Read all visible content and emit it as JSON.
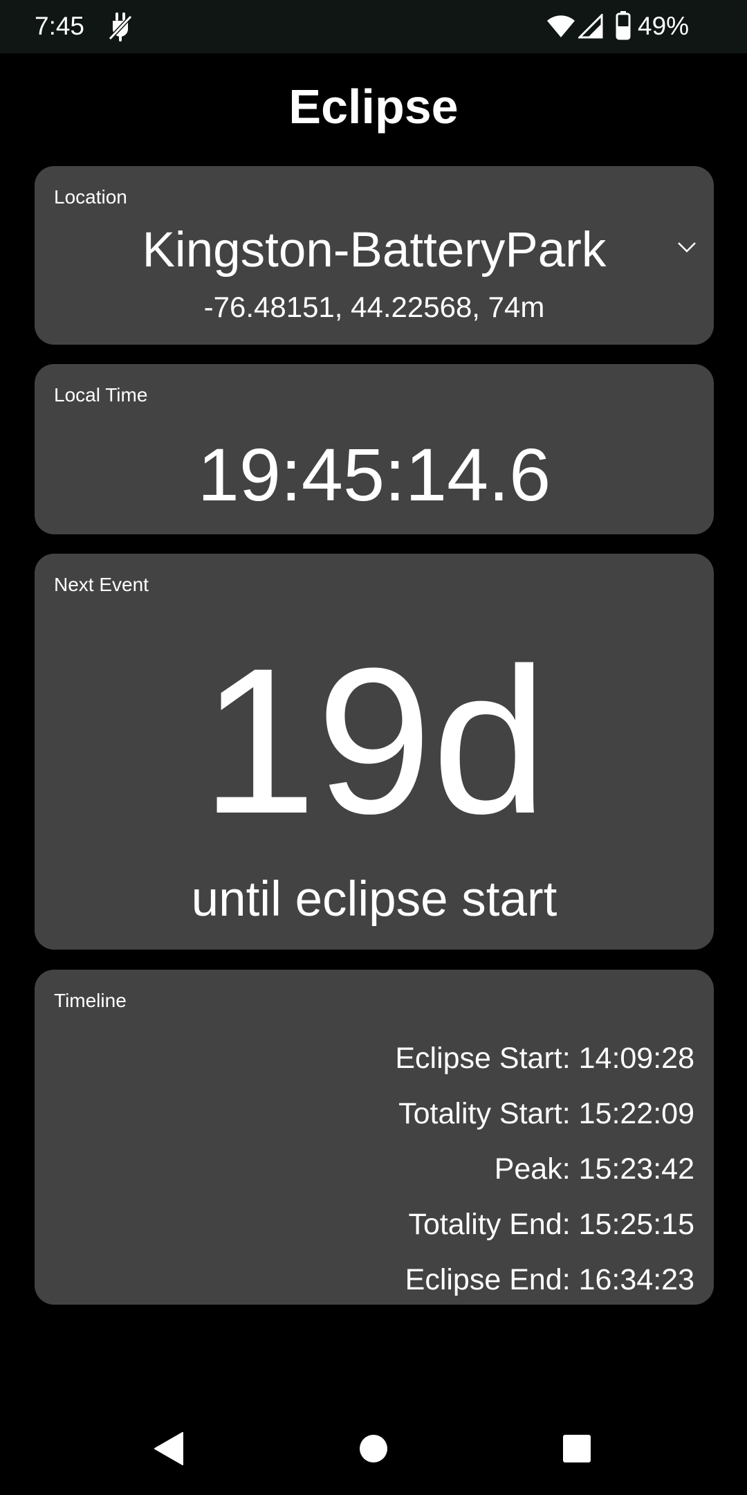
{
  "status_bar": {
    "time": "7:45",
    "battery": "49%",
    "icons": [
      "charge-icon",
      "wifi-icon",
      "signal-icon",
      "battery-icon"
    ]
  },
  "app": {
    "title": "Eclipse"
  },
  "location": {
    "label": "Location",
    "name": "Kingston-BatteryPark",
    "coords": "-76.48151, 44.22568, 74m"
  },
  "local_time": {
    "label": "Local Time",
    "value": "19:45:14.6"
  },
  "next_event": {
    "label": "Next Event",
    "value": "19d",
    "caption": "until eclipse start"
  },
  "timeline": {
    "label": "Timeline",
    "items": [
      "Eclipse Start: 14:09:28",
      "Totality Start: 15:22:09",
      "Peak: 15:23:42",
      "Totality End: 15:25:15",
      "Eclipse End: 16:34:23"
    ]
  },
  "nav": {
    "icons": [
      "back-icon",
      "home-icon",
      "recents-icon"
    ]
  },
  "colors": {
    "background": "#000000",
    "card": "#434343",
    "status_bar": "#0f1614",
    "text": "#ffffff"
  }
}
